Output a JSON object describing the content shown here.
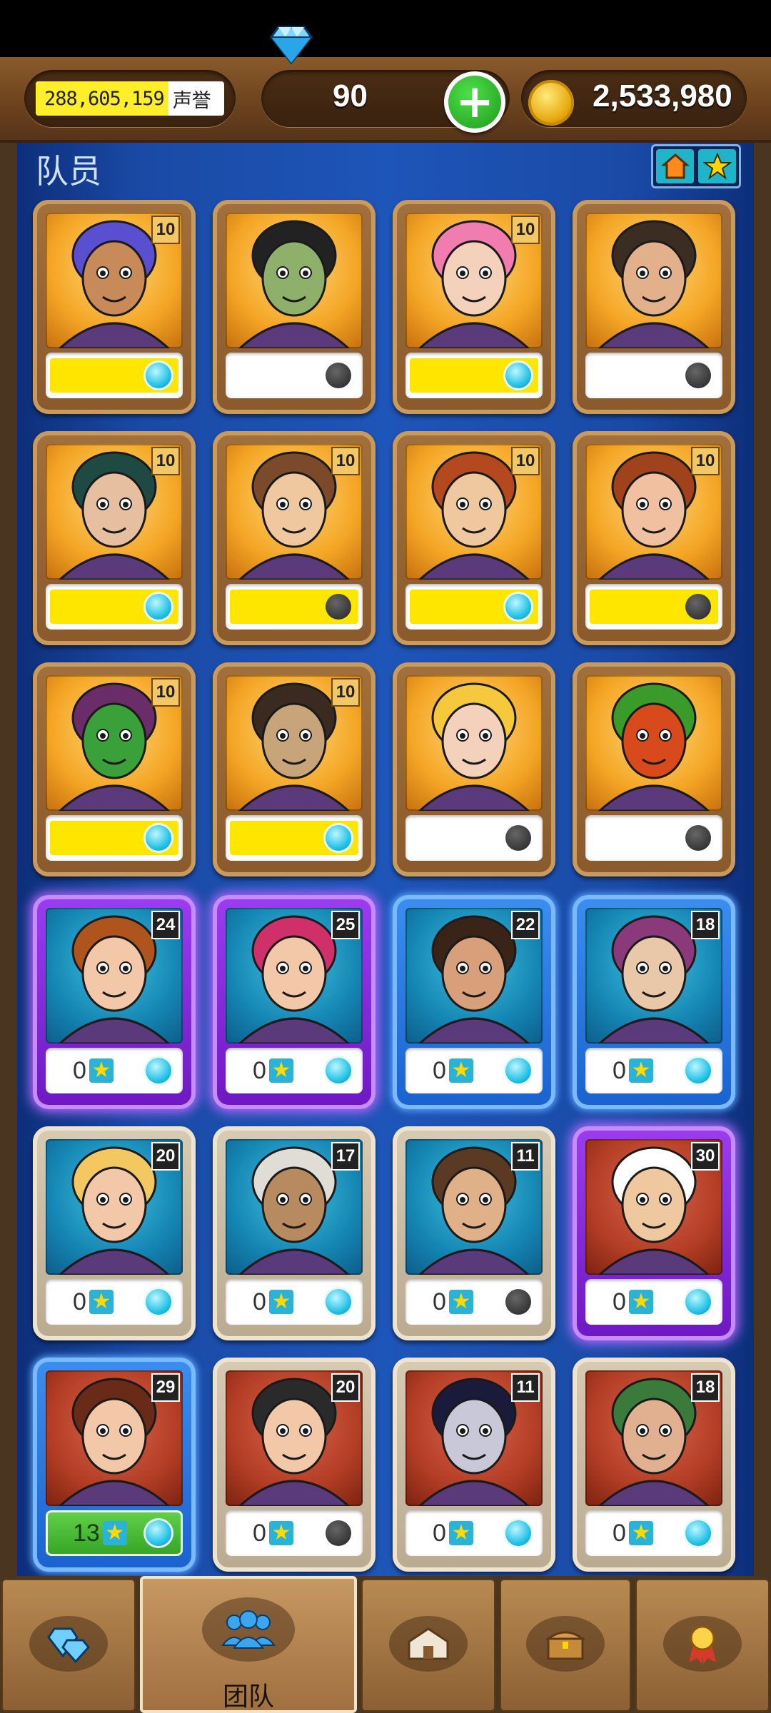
{
  "header": {
    "reputation_value": "288,605,159",
    "reputation_suffix": "声誉",
    "gems": "90",
    "coins": "2,533,980"
  },
  "section_title": "队员",
  "filter_toggle": {
    "left_icon": "house-icon",
    "right_icon": "star-icon"
  },
  "cards": [
    {
      "level": "10",
      "frame": "gold",
      "bg": "orange",
      "bar": "yellow",
      "dot": "cyan",
      "hair": "#5a4fd0",
      "skin": "#c98a5a"
    },
    {
      "level": "",
      "frame": "gold",
      "bg": "orange",
      "bar": "empty",
      "dot": "dark",
      "hair": "#222",
      "skin": "#8fb06a"
    },
    {
      "level": "10",
      "frame": "gold",
      "bg": "orange",
      "bar": "yellow",
      "dot": "cyan",
      "hair": "#f07cb0",
      "skin": "#f3d1bb"
    },
    {
      "level": "",
      "frame": "gold",
      "bg": "orange",
      "bar": "empty",
      "dot": "dark",
      "hair": "#3b2d22",
      "skin": "#e2b08a"
    },
    {
      "level": "10",
      "frame": "gold",
      "bg": "orange",
      "bar": "yellow",
      "dot": "cyan",
      "hair": "#1f4a44",
      "skin": "#e6bfa0"
    },
    {
      "level": "10",
      "frame": "gold",
      "bg": "orange",
      "bar": "yellow",
      "dot": "dark",
      "hair": "#7a4a2a",
      "skin": "#f0c8a0"
    },
    {
      "level": "10",
      "frame": "gold",
      "bg": "orange",
      "bar": "yellow",
      "dot": "cyan",
      "hair": "#b4481e",
      "skin": "#f0c8a0"
    },
    {
      "level": "10",
      "frame": "gold",
      "bg": "orange",
      "bar": "yellow",
      "dot": "dark",
      "hair": "#a0431c",
      "skin": "#f0c0a0"
    },
    {
      "level": "10",
      "frame": "gold",
      "bg": "orange",
      "bar": "yellow",
      "dot": "cyan",
      "hair": "#6a2d6a",
      "skin": "#3aa03a"
    },
    {
      "level": "10",
      "frame": "gold",
      "bg": "orange",
      "bar": "yellow",
      "dot": "cyan",
      "hair": "#3a2a20",
      "skin": "#c8a47a"
    },
    {
      "level": "",
      "frame": "gold",
      "bg": "orange",
      "bar": "empty",
      "dot": "dark",
      "hair": "#f6c83c",
      "skin": "#f3d1bb"
    },
    {
      "level": "",
      "frame": "gold",
      "bg": "orange",
      "bar": "empty",
      "dot": "dark",
      "hair": "#3a9a2a",
      "skin": "#d84a1c"
    },
    {
      "level": "24",
      "frame": "purple",
      "bg": "teal",
      "bar": "empty",
      "score": "0",
      "dot": "cyan",
      "hair": "#b0541e",
      "skin": "#f3c8a8"
    },
    {
      "level": "25",
      "frame": "purple",
      "bg": "teal",
      "bar": "empty",
      "score": "0",
      "dot": "cyan",
      "hair": "#d0306a",
      "skin": "#f3c8a8"
    },
    {
      "level": "22",
      "frame": "blue",
      "bg": "teal",
      "bar": "empty",
      "score": "0",
      "dot": "cyan",
      "hair": "#3a2418",
      "skin": "#d8a07a"
    },
    {
      "level": "18",
      "frame": "blue",
      "bg": "teal",
      "bar": "empty",
      "score": "0",
      "dot": "cyan",
      "hair": "#8a3a7a",
      "skin": "#e8c8a8"
    },
    {
      "level": "20",
      "frame": "silver",
      "bg": "teal",
      "bar": "empty",
      "score": "0",
      "dot": "cyan",
      "hair": "#f3c860",
      "skin": "#f3c8a8"
    },
    {
      "level": "17",
      "frame": "silver",
      "bg": "teal",
      "bar": "empty",
      "score": "0",
      "dot": "cyan",
      "hair": "#e0ddd6",
      "skin": "#b88a60"
    },
    {
      "level": "11",
      "frame": "silver",
      "bg": "teal",
      "bar": "empty",
      "score": "0",
      "dot": "dark",
      "hair": "#5a3a22",
      "skin": "#e0b088"
    },
    {
      "level": "30",
      "frame": "purple",
      "bg": "red",
      "bar": "empty",
      "score": "0",
      "dot": "cyan",
      "hair": "#ffffff",
      "skin": "#f0c8a0"
    },
    {
      "level": "29",
      "frame": "blue",
      "bg": "red",
      "bar": "green",
      "score": "13",
      "dot": "cyan",
      "hair": "#6a2a18",
      "skin": "#f3c8a8"
    },
    {
      "level": "20",
      "frame": "silver",
      "bg": "red",
      "bar": "empty",
      "score": "0",
      "dot": "dark",
      "hair": "#2a2a2a",
      "skin": "#f3c8a8"
    },
    {
      "level": "11",
      "frame": "silver",
      "bg": "red",
      "bar": "empty",
      "score": "0",
      "dot": "cyan",
      "hair": "#1a1a3a",
      "skin": "#c8c8d8"
    },
    {
      "level": "18",
      "frame": "silver",
      "bg": "red",
      "bar": "empty",
      "score": "0",
      "dot": "cyan",
      "hair": "#3a7a3a",
      "skin": "#e0b090"
    }
  ],
  "bottom_nav": [
    {
      "icon": "gems-icon",
      "label": ""
    },
    {
      "icon": "team-icon",
      "label": "团队",
      "active": true
    },
    {
      "icon": "buildings-icon",
      "label": ""
    },
    {
      "icon": "chest-icon",
      "label": ""
    },
    {
      "icon": "medal-icon",
      "label": ""
    }
  ]
}
